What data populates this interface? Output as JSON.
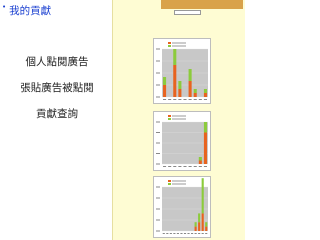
{
  "page": {
    "title": "我的貢獻",
    "bullet": "•"
  },
  "sidebar": {
    "items": [
      {
        "label": "個人點閱廣告"
      },
      {
        "label": "張貼廣告被點閱"
      },
      {
        "label": "貢獻查詢"
      }
    ]
  },
  "screenshot": {
    "header_title": "",
    "side_label": "",
    "select_value": "",
    "colors": {
      "panel_bg": "#fefcd3",
      "header_bg": "#d9a24a",
      "series_a": "#e8631f",
      "series_b": "#8ccb3c",
      "plot_bg": "#c8c8c8"
    }
  },
  "chart_data": [
    {
      "type": "bar",
      "categories": [
        "1",
        "2",
        "3",
        "4",
        "5",
        "6",
        "7",
        "8",
        "9"
      ],
      "series": [
        {
          "values": [
            3,
            0,
            8,
            2,
            0,
            4,
            1,
            0,
            1
          ]
        },
        {
          "values": [
            2,
            0,
            4,
            2,
            0,
            3,
            1,
            0,
            1
          ]
        }
      ],
      "ylim": [
        0,
        12
      ]
    },
    {
      "type": "bar",
      "categories": [
        "1",
        "2",
        "3",
        "4",
        "5",
        "6",
        "7",
        "8",
        "9"
      ],
      "series": [
        {
          "values": [
            0,
            0,
            0,
            0,
            0,
            0,
            0,
            1,
            9
          ]
        },
        {
          "values": [
            0,
            0,
            0,
            0,
            0,
            0,
            0,
            1,
            3
          ]
        }
      ],
      "ylim": [
        0,
        12
      ]
    },
    {
      "type": "bar",
      "categories": [
        "1",
        "2",
        "3",
        "4",
        "5",
        "6",
        "7",
        "8",
        "9",
        "10",
        "11",
        "12",
        "13"
      ],
      "series": [
        {
          "values": [
            0,
            0,
            0,
            0,
            0,
            0,
            0,
            0,
            0,
            1,
            2,
            4,
            1
          ]
        },
        {
          "values": [
            0,
            0,
            0,
            0,
            0,
            0,
            0,
            0,
            0,
            1,
            2,
            8,
            1
          ]
        }
      ],
      "ylim": [
        0,
        10
      ]
    }
  ]
}
